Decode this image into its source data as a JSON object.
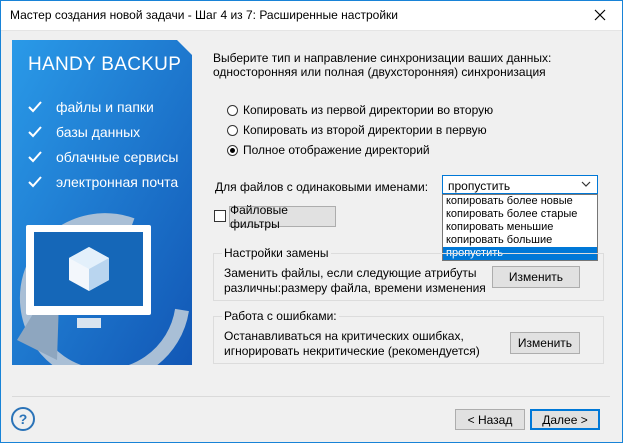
{
  "window": {
    "title": "Мастер создания новой задачи - Шаг 4 из 7: Расширенные настройки"
  },
  "banner": {
    "brand": "HANDY BACKUP",
    "features": [
      "файлы и папки",
      "базы данных",
      "облачные сервисы",
      "электронная почта"
    ]
  },
  "intro": "Выберите тип и направление синхронизации ваших данных: односторонняя или полная (двухсторонняя) синхронизация",
  "sync_options": [
    {
      "label": "Копировать из первой директории во вторую",
      "selected": false
    },
    {
      "label": "Копировать из второй директории в первую",
      "selected": false
    },
    {
      "label": "Полное отображение директорий",
      "selected": true
    }
  ],
  "same_names": {
    "label": "Для файлов с одинаковыми именами:",
    "value": "пропустить",
    "options": [
      "копировать более новые",
      "копировать более старые",
      "копировать меньшие",
      "копировать большие",
      "пропустить"
    ],
    "highlighted": "пропустить"
  },
  "filters": {
    "checked": false,
    "button": "Файловые фильтры"
  },
  "replace_group": {
    "title": "Настройки замены",
    "text_line1": "Заменить файлы, если следующие атрибуты",
    "text_line2": "различны:размеру файла, времени изменения",
    "button": "Изменить"
  },
  "errors_group": {
    "title": "Работа с ошибками:",
    "text_line1": "Останавливаться на критических ошибках,",
    "text_line2": "игнорировать некритические (рекомендуется)",
    "button": "Изменить"
  },
  "footer": {
    "back": "< Назад",
    "next": "Далее >",
    "help": "?"
  },
  "colors": {
    "accent": "#0078d7",
    "banner_dark": "#1565c0",
    "banner_light": "#2196f3"
  }
}
